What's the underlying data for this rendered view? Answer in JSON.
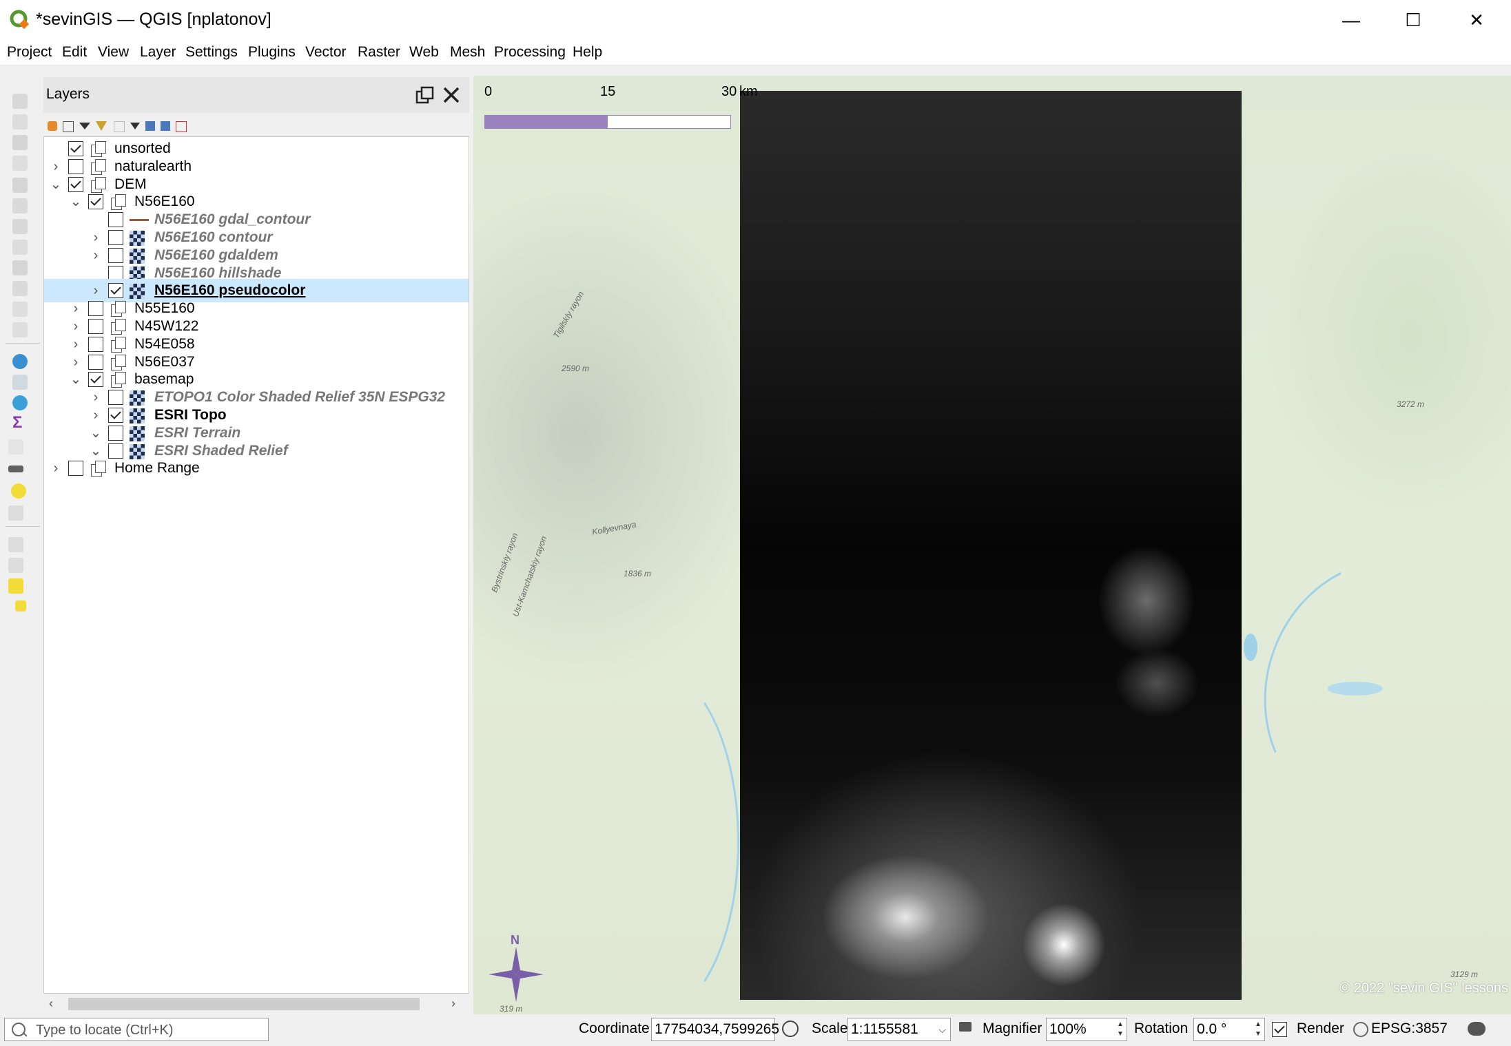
{
  "window": {
    "title": "*sevinGIS — QGIS [nplatonov]",
    "controls": [
      "—",
      "☐",
      "✕"
    ]
  },
  "menu": [
    "Project",
    "Edit",
    "View",
    "Layer",
    "Settings",
    "Plugins",
    "Vector",
    "Raster",
    "Web",
    "Mesh",
    "Processing",
    "Help"
  ],
  "layers_panel": {
    "title": "Layers",
    "rows": [
      {
        "label": "unsorted",
        "checked": true,
        "expander": "",
        "type": "group",
        "style": "normal"
      },
      {
        "label": "naturalearth",
        "checked": false,
        "expander": "›",
        "type": "group",
        "style": "normal"
      },
      {
        "label": "DEM",
        "checked": true,
        "expander": "⌄",
        "type": "group",
        "style": "normal"
      },
      {
        "label": "N56E160",
        "checked": true,
        "expander": "⌄",
        "type": "group",
        "style": "normal"
      },
      {
        "label": "N56E160 gdal_contour",
        "checked": false,
        "expander": "",
        "type": "line",
        "style": "inactive"
      },
      {
        "label": "N56E160 contour",
        "checked": false,
        "expander": "›",
        "type": "raster",
        "style": "inactive"
      },
      {
        "label": "N56E160 gdaldem",
        "checked": false,
        "expander": "›",
        "type": "raster",
        "style": "inactive"
      },
      {
        "label": "N56E160 hillshade",
        "checked": false,
        "expander": "",
        "type": "raster",
        "style": "inactive"
      },
      {
        "label": "N56E160 pseudocolor",
        "checked": true,
        "expander": "›",
        "type": "raster",
        "style": "current"
      },
      {
        "label": "N55E160",
        "checked": false,
        "expander": "›",
        "type": "group",
        "style": "normal"
      },
      {
        "label": "N45W122",
        "checked": false,
        "expander": "›",
        "type": "group",
        "style": "normal"
      },
      {
        "label": "N54E058",
        "checked": false,
        "expander": "›",
        "type": "group",
        "style": "normal"
      },
      {
        "label": "N56E037",
        "checked": false,
        "expander": "›",
        "type": "group",
        "style": "normal"
      },
      {
        "label": "basemap",
        "checked": true,
        "expander": "⌄",
        "type": "group",
        "style": "normal"
      },
      {
        "label": "ETOPO1 Color Shaded Relief 35N ESPG32",
        "checked": false,
        "expander": "›",
        "type": "raster",
        "style": "inactive"
      },
      {
        "label": "ESRI Topo",
        "checked": true,
        "expander": "›",
        "type": "raster",
        "style": "bold"
      },
      {
        "label": "ESRI Terrain",
        "checked": false,
        "expander": "⌄",
        "type": "raster",
        "style": "inactive"
      },
      {
        "label": "ESRI Shaded Relief",
        "checked": false,
        "expander": "⌄",
        "type": "raster",
        "style": "inactive"
      },
      {
        "label": "Home Range",
        "checked": false,
        "expander": "›",
        "type": "group",
        "style": "normal"
      }
    ]
  },
  "map": {
    "scalebar": {
      "ticks": [
        "0",
        "15",
        "30"
      ],
      "unit": "km",
      "color": "#9a84bf"
    },
    "north_label": "N",
    "copyright": "© 2022 \"sevin GIS\" lessons",
    "place_labels": [
      "Tigilskiy rayon",
      "2590 m",
      "Bystrinskiy rayon",
      "Ust-Kamchatskiy rayon",
      "Kollyevnaya",
      "1836 m",
      "3272 m",
      "3129 m",
      "319 m"
    ]
  },
  "statusbar": {
    "locator_placeholder": "Type to locate (Ctrl+K)",
    "coordinate_label": "Coordinate",
    "coordinate_value": "17754034,7599265",
    "scale_label": "Scale",
    "scale_value": "1:1155581",
    "magnifier_label": "Magnifier",
    "magnifier_value": "100%",
    "rotation_label": "Rotation",
    "rotation_value": "0.0 °",
    "render_label": "Render",
    "render_checked": true,
    "crs": "EPSG:3857"
  },
  "colors": {
    "selection": "#cce8ff",
    "inactive_text": "#777777",
    "qgis_green": "#589632",
    "qgis_yellow": "#ee7913"
  }
}
